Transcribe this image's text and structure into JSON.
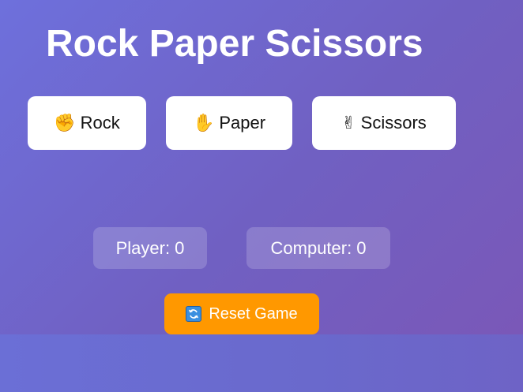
{
  "title": "Rock Paper Scissors",
  "choices": [
    {
      "icon": "raised-fist-icon",
      "emoji": "✊",
      "label": "Rock"
    },
    {
      "icon": "raised-hand-icon",
      "emoji": "✋",
      "label": "Paper"
    },
    {
      "icon": "victory-hand-icon",
      "emoji": "✌",
      "label": "Scissors"
    }
  ],
  "scores": {
    "player_label": "Player:",
    "player_value": "0",
    "computer_label": "Computer:",
    "computer_value": "0"
  },
  "reset": {
    "icon": "refresh-icon",
    "label": "Reset Game"
  },
  "colors": {
    "background": "#6e6ad4",
    "reset_button": "#ff9800",
    "choice_button": "#ffffff"
  }
}
